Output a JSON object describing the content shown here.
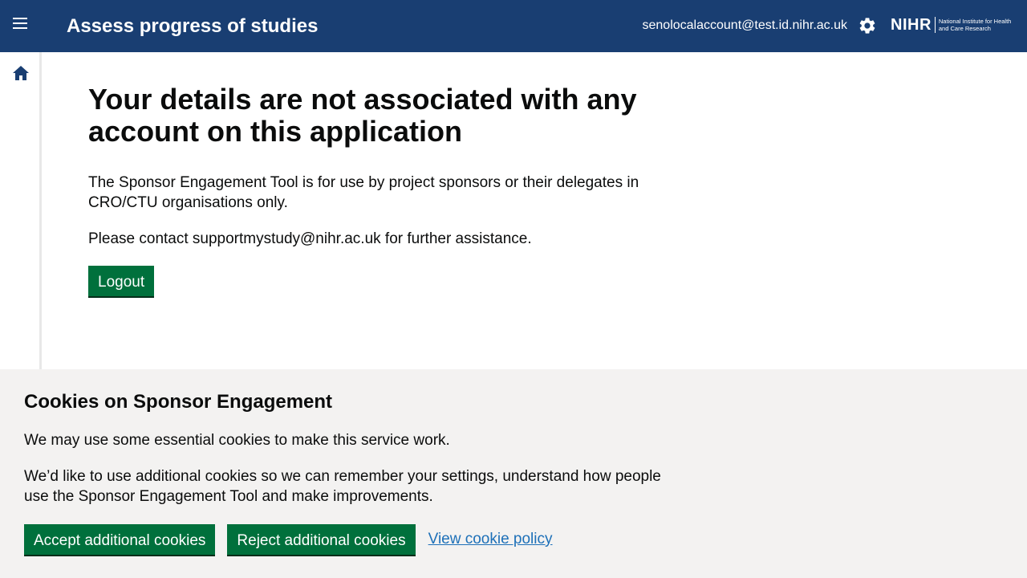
{
  "header": {
    "menu_icon": "hamburger-menu-icon",
    "title": "Assess progress of studies",
    "user_email": "senolocalaccount@test.id.nihr.ac.uk",
    "settings_icon": "gear-icon",
    "logo_text": "NIHR",
    "logo_subtext": "National Institute for Health and Care Research",
    "background_color": "#193e72"
  },
  "sidebar": {
    "home_icon": "home-icon"
  },
  "main": {
    "heading": "Your details are not associated with any account on this application",
    "paragraph_1": "The Sponsor Engagement Tool is for use by project sponsors or their delegates in CRO/CTU organisations only.",
    "paragraph_2": "Please contact supportmystudy@nihr.ac.uk for further assistance.",
    "logout_label": "Logout",
    "button_color": "#00703c"
  },
  "cookie_banner": {
    "heading": "Cookies on Sponsor Engagement",
    "paragraph_1": "We may use some essential cookies to make this service work.",
    "paragraph_2": "We’d like to use additional cookies so we can remember your settings, understand how people use the Sponsor Engagement Tool and make improvements.",
    "accept_label": "Accept additional cookies",
    "reject_label": "Reject additional cookies",
    "policy_link": "View cookie policy",
    "link_color": "#1d70b8"
  }
}
